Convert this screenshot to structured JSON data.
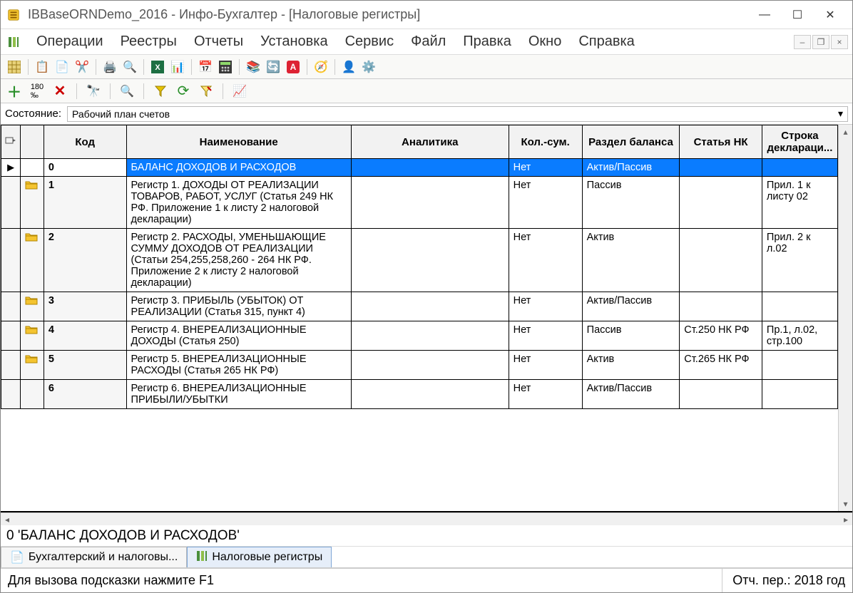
{
  "window": {
    "title": "IBBaseORNDemo_2016 - Инфо-Бухгалтер - [Налоговые регистры]"
  },
  "menu": {
    "items": [
      "Операции",
      "Реестры",
      "Отчеты",
      "Установка",
      "Сервис",
      "Файл",
      "Правка",
      "Окно",
      "Справка"
    ]
  },
  "state": {
    "label": "Состояние:",
    "value": "Рабочий план счетов"
  },
  "columns": {
    "code": "Код",
    "name": "Наименование",
    "analytic": "Аналитика",
    "kolsum": "Кол.-сум.",
    "razdel": "Раздел баланса",
    "stat": "Статья НК",
    "stroka": "Строка деклараци..."
  },
  "rows": [
    {
      "selected": true,
      "folder": false,
      "marker": "▶",
      "code": "0",
      "name": "БАЛАНС ДОХОДОВ И РАСХОДОВ",
      "analytic": "",
      "kol": "Нет",
      "razdel": "Актив/Пассив",
      "stat": "",
      "stroka": ""
    },
    {
      "selected": false,
      "folder": true,
      "marker": "",
      "code": "1",
      "name": "Регистр 1. ДОХОДЫ ОТ РЕАЛИЗАЦИИ ТОВАРОВ, РАБОТ, УСЛУГ (Статья 249 НК РФ. Приложение 1 к листу 2 налоговой декларации)",
      "analytic": "",
      "kol": "Нет",
      "razdel": "Пассив",
      "stat": "",
      "stroka": "Прил. 1 к листу 02"
    },
    {
      "selected": false,
      "folder": true,
      "marker": "",
      "code": "2",
      "name": "Регистр 2. РАСХОДЫ, УМЕНЬШАЮЩИЕ СУММУ ДОХОДОВ ОТ РЕАЛИЗАЦИИ (Статьи 254,255,258,260 - 264 НК РФ. Приложение 2 к листу 2 налоговой декларации)",
      "analytic": "",
      "kol": "Нет",
      "razdel": "Актив",
      "stat": "",
      "stroka": "Прил. 2 к л.02"
    },
    {
      "selected": false,
      "folder": true,
      "marker": "",
      "code": "3",
      "name": "Регистр 3. ПРИБЫЛЬ (УБЫТОК) ОТ РЕАЛИЗАЦИИ (Статья 315, пункт 4)",
      "analytic": "",
      "kol": "Нет",
      "razdel": "Актив/Пассив",
      "stat": "",
      "stroka": ""
    },
    {
      "selected": false,
      "folder": true,
      "marker": "",
      "code": "4",
      "name": "Регистр 4. ВНЕРЕАЛИЗАЦИОННЫЕ ДОХОДЫ (Статья 250)",
      "analytic": "",
      "kol": "Нет",
      "razdel": "Пассив",
      "stat": "Ст.250 НК РФ",
      "stroka": "Пр.1, л.02, стр.100"
    },
    {
      "selected": false,
      "folder": true,
      "marker": "",
      "code": "5",
      "name": "Регистр 5. ВНЕРЕАЛИЗАЦИОННЫЕ РАСХОДЫ (Статья 265 НК РФ)",
      "analytic": "",
      "kol": "Нет",
      "razdel": "Актив",
      "stat": "Ст.265 НК РФ",
      "stroka": ""
    },
    {
      "selected": false,
      "folder": false,
      "marker": "",
      "code": "6",
      "name": "Регистр 6. ВНЕРЕАЛИЗАЦИОННЫЕ ПРИБЫЛИ/УБЫТКИ",
      "analytic": "",
      "kol": "Нет",
      "razdel": "Актив/Пассив",
      "stat": "",
      "stroka": ""
    }
  ],
  "status": {
    "breadcrumb": "0 'БАЛАНС ДОХОДОВ И РАСХОДОВ'",
    "hint": "Для вызова подсказки нажмите F1",
    "period": "Отч. пер.: 2018 год"
  },
  "tabs": [
    {
      "label": "Бухгалтерский и налоговы...",
      "active": false
    },
    {
      "label": "Налоговые регистры",
      "active": true
    }
  ]
}
